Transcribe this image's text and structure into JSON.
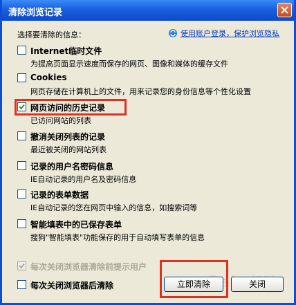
{
  "window": {
    "title": "清除浏览记录"
  },
  "prompt": "选择要清除的信息：",
  "privacy_link": "使用账户登录，保护浏览隐私",
  "options": [
    {
      "title": "Internet临时文件",
      "desc": "为提高页面显示速度而保存的网页、图像和媒体的缓存文件",
      "checked": false
    },
    {
      "title": "Cookies",
      "desc": "网页存储在计算机上的文件，用来记录您的身份信息等个性化设置",
      "checked": false
    },
    {
      "title": "网页访问的历史记录",
      "desc": "已访问网站的列表",
      "checked": true
    },
    {
      "title": "撤消关闭列表的记录",
      "desc": "最近被关闭的网站列表",
      "checked": false
    },
    {
      "title": "记录的用户名密码信息",
      "desc": "IE自动记录的用户名及密码信息",
      "checked": false
    },
    {
      "title": "记录的表单数据",
      "desc": "IE自动记录的您在网页中输入的信息，如搜索词等",
      "checked": false
    },
    {
      "title": "智能填表中的已保存表单",
      "desc": "搜狗\"智能填表\"功能保存的用于自动填写表单的信息",
      "checked": false
    }
  ],
  "disabled_option": {
    "label": "每次关闭浏览器清除前提示用户",
    "checked": true
  },
  "close_clear_option": {
    "label": "每次关闭浏览器后清除",
    "checked": false
  },
  "buttons": {
    "clear_now": "立即清除",
    "close": "关闭"
  },
  "colors": {
    "titlebar": "#1a5fe0",
    "dialog_bg": "#ece9d8",
    "highlight": "#e03020",
    "link": "#0a3fc7"
  }
}
